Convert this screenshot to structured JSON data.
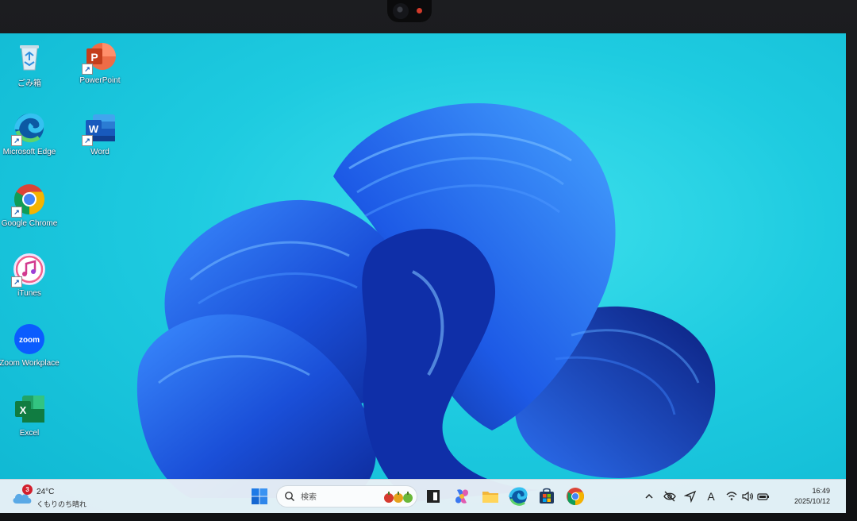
{
  "desktop": {
    "icons": [
      {
        "label": "ごみ箱",
        "icon": "recycle-bin-icon"
      },
      {
        "label": "PowerPoint",
        "icon": "powerpoint-icon"
      },
      {
        "label": "Microsoft Edge",
        "icon": "edge-icon"
      },
      {
        "label": "Word",
        "icon": "word-icon"
      },
      {
        "label": "Google Chrome",
        "icon": "chrome-icon"
      },
      {
        "label": "iTunes",
        "icon": "itunes-icon"
      },
      {
        "label": "Zoom Workplace",
        "icon": "zoom-icon"
      },
      {
        "label": "Excel",
        "icon": "excel-icon"
      }
    ],
    "zoom_tile_text": "zoom",
    "letters": {
      "powerpoint": "P",
      "word": "W",
      "excel": "X"
    }
  },
  "taskbar": {
    "weather": {
      "badge": "3",
      "temp": "24°C",
      "desc": "くもりのち晴れ"
    },
    "search": {
      "placeholder": "検索"
    },
    "apps": [
      "windows-start-icon",
      "search-icon",
      "task-view-icon",
      "copilot-icon",
      "file-explorer-icon",
      "edge-icon",
      "store-icon",
      "chrome-icon"
    ],
    "tray": [
      "chevron-up-icon",
      "eye-off-icon",
      "location-icon",
      "ime-icon",
      "wifi-icon",
      "volume-icon",
      "battery-icon"
    ],
    "ime_label": "A",
    "clock": {
      "time": "16:49",
      "date": "2025/10/12"
    }
  },
  "colors": {
    "desktop_bg": "#1ecbe0",
    "bloom": "#1f56e0",
    "taskbar": "#e9f0f6"
  }
}
